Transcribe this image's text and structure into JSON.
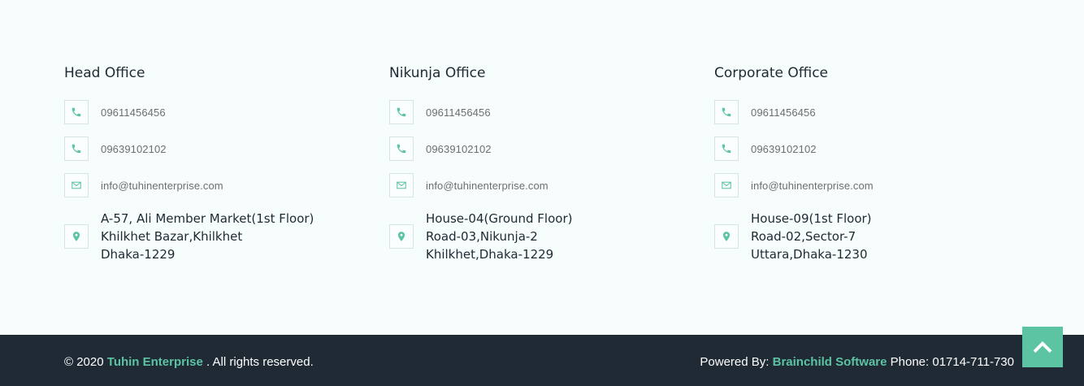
{
  "colors": {
    "accent": "#5cc3a3",
    "footer_bg": "#1f2a35",
    "page_bg": "#f7fcfc"
  },
  "offices": [
    {
      "title": "Head Office",
      "phone1": "09611456456",
      "phone2": "09639102102",
      "email": "info@tuhinenterprise.com",
      "address": [
        "A-57, Ali Member Market(1st Floor)",
        "Khilkhet Bazar,Khilkhet",
        "Dhaka-1229"
      ]
    },
    {
      "title": "Nikunja Office",
      "phone1": "09611456456",
      "phone2": "09639102102",
      "email": "info@tuhinenterprise.com",
      "address": [
        "House-04(Ground Floor)",
        "Road-03,Nikunja-2",
        "Khilkhet,Dhaka-1229"
      ]
    },
    {
      "title": "Corporate Office",
      "phone1": "09611456456",
      "phone2": "09639102102",
      "email": "info@tuhinenterprise.com",
      "address": [
        "House-09(1st Floor)",
        "Road-02,Sector-7",
        "Uttara,Dhaka-1230"
      ]
    }
  ],
  "icons": {
    "phone": "phone-icon",
    "email": "envelope-icon",
    "address": "map-pin-icon",
    "top": "chevron-up-icon"
  },
  "footer": {
    "copyright_prefix": "© 2020",
    "company": "Tuhin Enterprise",
    "copyright_suffix": ". All rights reserved.",
    "powered_prefix": "Powered By:",
    "powered_brand": "Brainchild Software",
    "phone": "Phone: 01714-711-730"
  }
}
